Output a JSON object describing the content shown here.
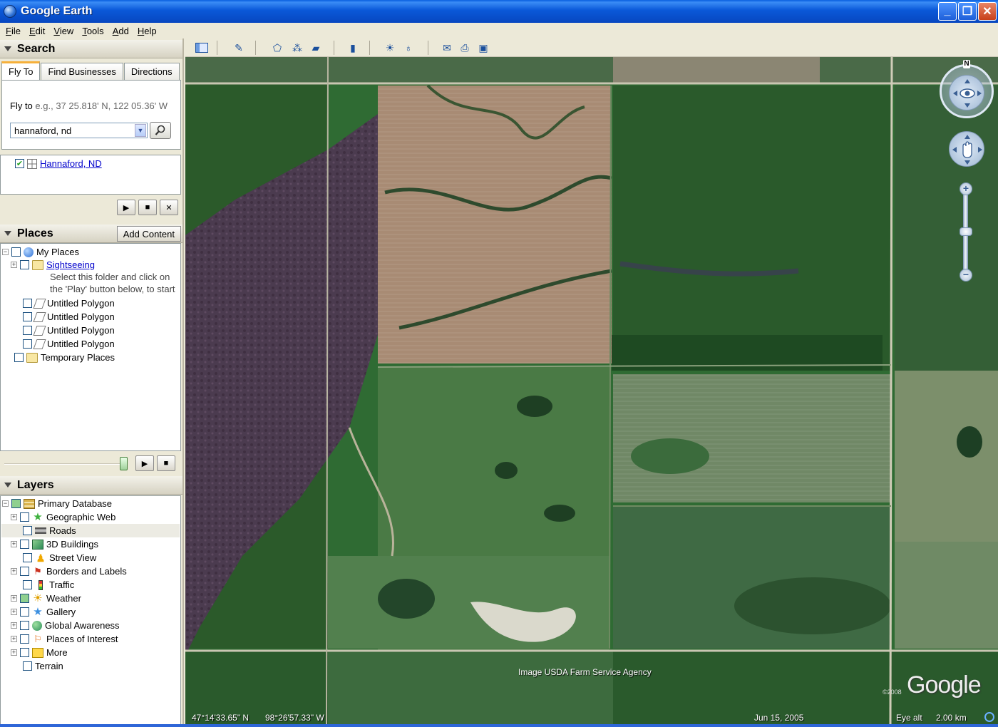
{
  "window": {
    "title": "Google Earth",
    "minimize": "_",
    "maximize": "❐",
    "close": "✕"
  },
  "menu": [
    "File",
    "Edit",
    "View",
    "Tools",
    "Add",
    "Help"
  ],
  "search": {
    "header": "Search",
    "tabs": [
      "Fly To",
      "Find Businesses",
      "Directions"
    ],
    "fly_label": "Fly to",
    "fly_hint": "e.g., 37 25.818' N, 122 05.36' W",
    "input_value": "hannaford, nd",
    "result": "Hannaford, ND"
  },
  "places": {
    "header": "Places",
    "add_content": "Add Content",
    "items": {
      "my_places": "My Places",
      "sightseeing": "Sightseeing",
      "note1": "Select this folder and click on",
      "note2": "the 'Play' button below, to start",
      "poly1": "Untitled Polygon",
      "poly2": "Untitled Polygon",
      "poly3": "Untitled Polygon",
      "poly4": "Untitled Polygon",
      "temporary": "Temporary Places"
    }
  },
  "layers": {
    "header": "Layers",
    "items": {
      "primary": "Primary Database",
      "geoweb": "Geographic Web",
      "roads": "Roads",
      "buildings": "3D Buildings",
      "streetview": "Street View",
      "borders": "Borders and Labels",
      "traffic": "Traffic",
      "weather": "Weather",
      "gallery": "Gallery",
      "awareness": "Global Awareness",
      "poi": "Places of Interest",
      "more": "More",
      "terrain": "Terrain"
    }
  },
  "map": {
    "attribution": "Image USDA Farm Service Agency",
    "logo": "Google",
    "copyright": "©2008",
    "lat": "47°14'33.65\" N",
    "lon": "98°26'57.33\" W",
    "date": "Jun 15, 2005",
    "eye_alt_label": "Eye alt",
    "eye_alt": "2.00 km",
    "north": "N"
  }
}
